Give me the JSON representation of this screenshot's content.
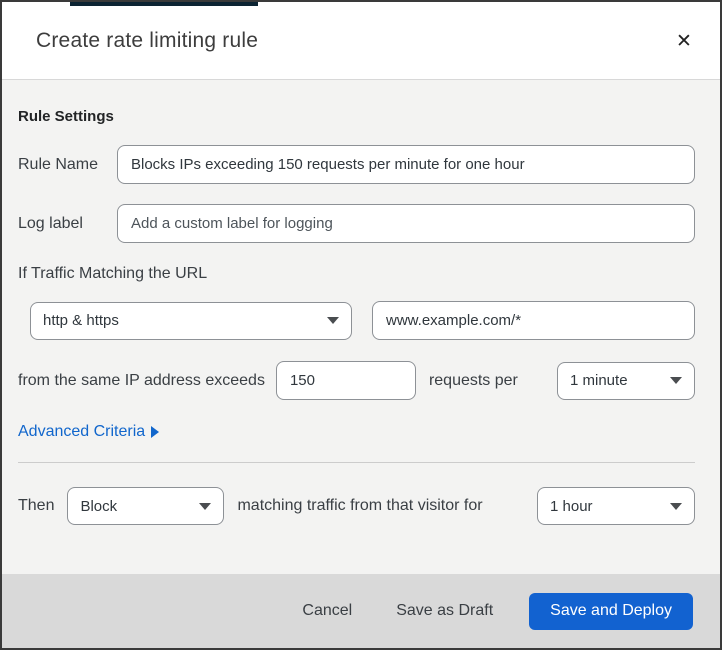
{
  "dialog": {
    "title": "Create rate limiting rule",
    "close_icon": "✕"
  },
  "form": {
    "section_heading": "Rule Settings",
    "rule_name": {
      "label": "Rule Name",
      "value": "Blocks IPs exceeding 150 requests per minute for one hour"
    },
    "log_label": {
      "label": "Log label",
      "placeholder": "Add a custom label for logging"
    },
    "traffic_heading": "If Traffic Matching the URL",
    "scheme_select": {
      "value": "http & https"
    },
    "url_input": {
      "value": "www.example.com/*"
    },
    "threshold": {
      "prefix": "from the same IP address exceeds",
      "requests_value": "150",
      "middle": "requests per",
      "period_value": "1 minute"
    },
    "advanced_link": {
      "label": "Advanced Criteria"
    },
    "then": {
      "prefix": "Then",
      "action_value": "Block",
      "middle": "matching traffic from that visitor for",
      "duration_value": "1 hour"
    }
  },
  "footer": {
    "cancel_label": "Cancel",
    "save_draft_label": "Save as Draft",
    "save_deploy_label": "Save and Deploy"
  },
  "colors": {
    "accent_blue": "#1262d0",
    "link_blue": "#1166cc",
    "top_strip": "#0c2433",
    "body_bg": "#f3f3f2",
    "footer_bg": "#d9d9d9"
  }
}
